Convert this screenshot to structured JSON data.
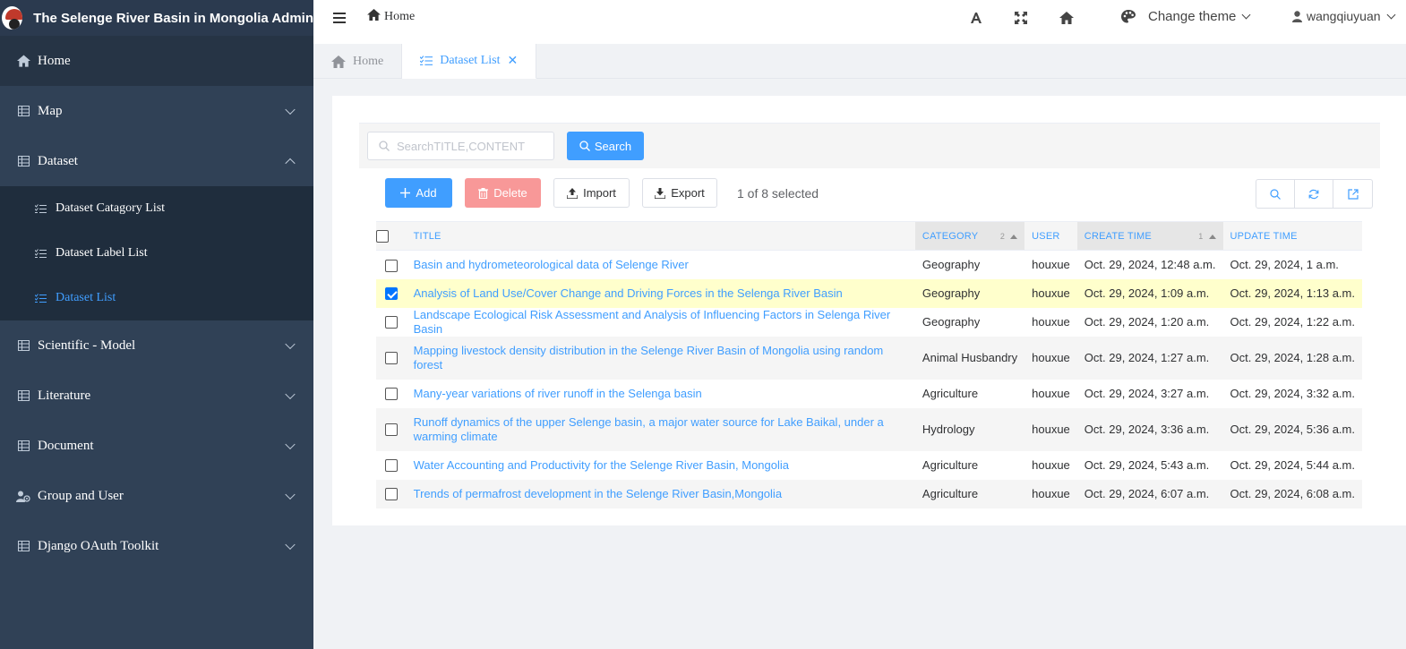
{
  "app": {
    "title": "The Selenge River Basin in Mongolia Admin"
  },
  "sidebar": {
    "items": [
      {
        "label": "Home",
        "icon": "home-icon"
      },
      {
        "label": "Map",
        "icon": "table-icon"
      },
      {
        "label": "Dataset",
        "icon": "table-icon"
      },
      {
        "label": "Scientific - Model",
        "icon": "table-icon"
      },
      {
        "label": "Literature",
        "icon": "table-icon"
      },
      {
        "label": "Document",
        "icon": "table-icon"
      },
      {
        "label": "Group and User",
        "icon": "user-group-icon"
      },
      {
        "label": "Django OAuth Toolkit",
        "icon": "table-icon"
      }
    ],
    "dataset_sub": [
      {
        "label": "Dataset Catagory List",
        "icon": "list-icon"
      },
      {
        "label": "Dataset Label List",
        "icon": "list-icon"
      },
      {
        "label": "Dataset List",
        "icon": "list-icon"
      }
    ],
    "active_color": "#409eff"
  },
  "topbar": {
    "breadcrumb": "Home",
    "theme_label": "Change theme",
    "username": "wangqiuyuan"
  },
  "tabs": [
    {
      "label": "Home"
    },
    {
      "label": "Dataset List"
    }
  ],
  "search": {
    "placeholder": "SearchTITLE,CONTENT",
    "button": "Search"
  },
  "toolbar": {
    "add": "Add",
    "delete": "Delete",
    "import": "Import",
    "export": "Export",
    "selection": "1 of 8 selected"
  },
  "table": {
    "headers": {
      "title": "TITLE",
      "category": "CATEGORY",
      "category_sort": "2",
      "user": "USER",
      "create_time": "CREATE TIME",
      "create_sort": "1",
      "update_time": "UPDATE TIME"
    },
    "rows": [
      {
        "title": "Basin and hydrometeorological data of Selenge River",
        "category": "Geography",
        "user": "houxue",
        "create_time": "Oct. 29, 2024, 12:48 a.m.",
        "update_time": "Oct. 29, 2024, 1 a.m.",
        "checked": false
      },
      {
        "title": "Analysis of Land Use/Cover Change and Driving Forces in the Selenga River Basin",
        "category": "Geography",
        "user": "houxue",
        "create_time": "Oct. 29, 2024, 1:09 a.m.",
        "update_time": "Oct. 29, 2024, 1:13 a.m.",
        "checked": true
      },
      {
        "title": "Landscape Ecological Risk Assessment and Analysis of Influencing Factors in Selenga River Basin",
        "category": "Geography",
        "user": "houxue",
        "create_time": "Oct. 29, 2024, 1:20 a.m.",
        "update_time": "Oct. 29, 2024, 1:22 a.m.",
        "checked": false
      },
      {
        "title": "Mapping livestock density distribution in the Selenge River Basin of Mongolia using random forest",
        "category": "Animal Husbandry",
        "user": "houxue",
        "create_time": "Oct. 29, 2024, 1:27 a.m.",
        "update_time": "Oct. 29, 2024, 1:28 a.m.",
        "checked": false
      },
      {
        "title": "Many-year variations of river runoff in the Selenga basin",
        "category": "Agriculture",
        "user": "houxue",
        "create_time": "Oct. 29, 2024, 3:27 a.m.",
        "update_time": "Oct. 29, 2024, 3:32 a.m.",
        "checked": false
      },
      {
        "title": "Runoff dynamics of the upper Selenge basin, a major water source for Lake Baikal, under a warming climate",
        "category": "Hydrology",
        "user": "houxue",
        "create_time": "Oct. 29, 2024, 3:36 a.m.",
        "update_time": "Oct. 29, 2024, 5:36 a.m.",
        "checked": false
      },
      {
        "title": "Water Accounting and Productivity for the Selenge River Basin, Mongolia",
        "category": "Agriculture",
        "user": "houxue",
        "create_time": "Oct. 29, 2024, 5:43 a.m.",
        "update_time": "Oct. 29, 2024, 5:44 a.m.",
        "checked": false
      },
      {
        "title": "Trends of permafrost development in the Selenge River Basin,Mongolia",
        "category": "Agriculture",
        "user": "houxue",
        "create_time": "Oct. 29, 2024, 6:07 a.m.",
        "update_time": "Oct. 29, 2024, 6:08 a.m.",
        "checked": false
      }
    ]
  }
}
